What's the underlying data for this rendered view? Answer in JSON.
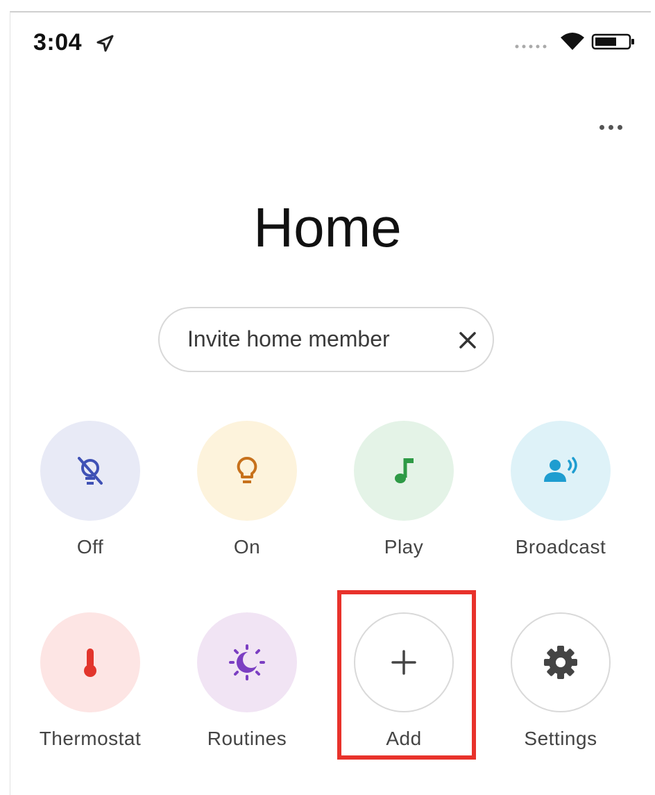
{
  "status_bar": {
    "time": "3:04"
  },
  "header": {
    "title": "Home"
  },
  "invite_chip": {
    "label": "Invite home member"
  },
  "actions_row1": [
    {
      "label": "Off",
      "icon": "light-off-icon",
      "bg": "#e8eaf6",
      "color": "#3f51b5"
    },
    {
      "label": "On",
      "icon": "lightbulb-icon",
      "bg": "#fdf3dc",
      "color": "#c7711c"
    },
    {
      "label": "Play",
      "icon": "music-note-icon",
      "bg": "#e4f3e7",
      "color": "#2e9a46"
    },
    {
      "label": "Broadcast",
      "icon": "broadcast-icon",
      "bg": "#def2f8",
      "color": "#1e9dd0"
    }
  ],
  "actions_row2": [
    {
      "label": "Thermostat",
      "icon": "thermometer-icon",
      "bg": "#fde5e4",
      "color": "#e2352c"
    },
    {
      "label": "Routines",
      "icon": "routines-icon",
      "bg": "#f1e4f4",
      "color": "#7b3ec2"
    },
    {
      "label": "Add",
      "icon": "plus-icon",
      "bg": "#ffffff",
      "color": "#444444"
    },
    {
      "label": "Settings",
      "icon": "gear-icon",
      "bg": "#ffffff",
      "color": "#444444"
    }
  ],
  "highlight_color": "#e8322b"
}
